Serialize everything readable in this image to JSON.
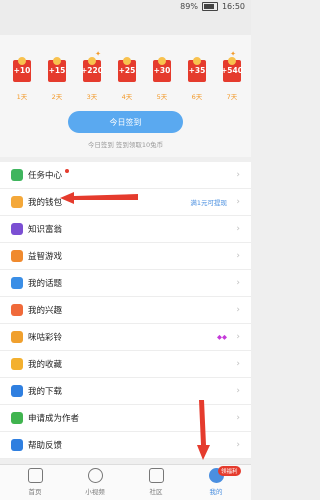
{
  "status": {
    "battery": "89%",
    "time": "16:50"
  },
  "signin": {
    "days": [
      {
        "amount": "+10",
        "label": "1天"
      },
      {
        "amount": "+15",
        "label": "2天"
      },
      {
        "amount": "+220",
        "label": "3天"
      },
      {
        "amount": "+25",
        "label": "4天"
      },
      {
        "amount": "+30",
        "label": "5天"
      },
      {
        "amount": "+35",
        "label": "6天"
      },
      {
        "amount": "+540",
        "label": "7天"
      }
    ],
    "button": "今日签到",
    "note": "今日签到 签到领取10兔币"
  },
  "menu": [
    {
      "label": "任务中心",
      "color": "#3fb55e",
      "dot": true
    },
    {
      "label": "我的钱包",
      "color": "#f4a83a",
      "hint": "满1元可提现"
    },
    {
      "label": "知识富翁",
      "color": "#7b4fd3"
    },
    {
      "label": "益智游戏",
      "color": "#f08a2e"
    },
    {
      "label": "我的话题",
      "color": "#3a8ee6"
    },
    {
      "label": "我的兴趣",
      "color": "#f06a3a"
    },
    {
      "label": "咪咕彩铃",
      "color": "#f0a02e"
    },
    {
      "label": "我的收藏",
      "color": "#f3b02f"
    },
    {
      "label": "我的下载",
      "color": "#2f7fe0"
    },
    {
      "label": "申请成为作者",
      "color": "#40b44f"
    },
    {
      "label": "帮助反馈",
      "color": "#2f7fe0"
    }
  ],
  "tabs": [
    {
      "label": "首页"
    },
    {
      "label": "小视频"
    },
    {
      "label": "社区"
    },
    {
      "label": "我的",
      "badge": "领福利"
    }
  ]
}
